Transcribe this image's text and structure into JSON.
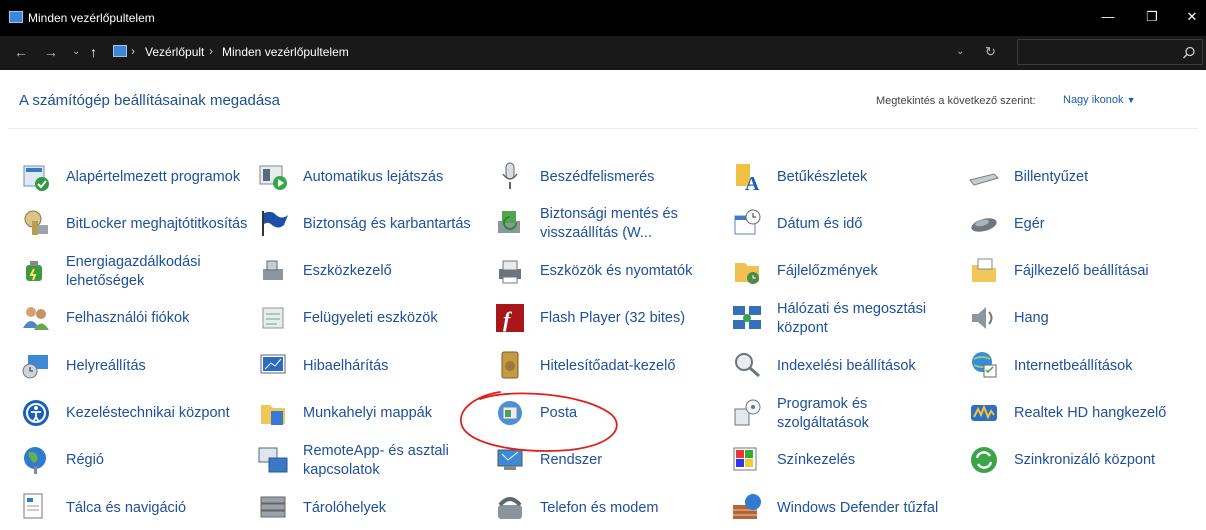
{
  "window": {
    "title": "Minden vezérlőpultelem",
    "minimize_glyph": "—",
    "restore_glyph": "❐",
    "close_glyph": "✕"
  },
  "address": {
    "crumbs": [
      "Vezérlőpult",
      "Minden vezérlőpultelem"
    ],
    "separator": "›",
    "search_placeholder": ""
  },
  "header": {
    "title": "A számítógép beállításainak megadása",
    "view_by_label": "Megtekintés a következő szerint:",
    "view_by_value": "Nagy ikonok"
  },
  "items": [
    {
      "label": "Alapértelmezett programok",
      "icon": "default-programs-icon"
    },
    {
      "label": "Automatikus lejátszás",
      "icon": "autoplay-icon"
    },
    {
      "label": "Beszédfelismerés",
      "icon": "microphone-icon"
    },
    {
      "label": "Betűkészletek",
      "icon": "fonts-icon"
    },
    {
      "label": "Billentyűzet",
      "icon": "keyboard-icon"
    },
    {
      "label": "BitLocker meghajtótitkosítás",
      "icon": "bitlocker-icon"
    },
    {
      "label": "Biztonság és karbantartás",
      "icon": "flag-icon"
    },
    {
      "label": "Biztonsági mentés és visszaállítás (W...",
      "icon": "backup-icon"
    },
    {
      "label": "Dátum és idő",
      "icon": "datetime-icon"
    },
    {
      "label": "Egér",
      "icon": "mouse-icon"
    },
    {
      "label": "Energiagazdálkodási lehetőségek",
      "icon": "power-icon"
    },
    {
      "label": "Eszközkezelő",
      "icon": "device-manager-icon"
    },
    {
      "label": "Eszközök és nyomtatók",
      "icon": "printer-icon"
    },
    {
      "label": "Fájlelőzmények",
      "icon": "file-history-icon"
    },
    {
      "label": "Fájlkezelő beállításai",
      "icon": "folder-options-icon"
    },
    {
      "label": "Felhasználói fiókok",
      "icon": "users-icon"
    },
    {
      "label": "Felügyeleti eszközök",
      "icon": "admin-tools-icon"
    },
    {
      "label": "Flash Player (32 bites)",
      "icon": "flash-icon"
    },
    {
      "label": "Hálózati és megosztási központ",
      "icon": "network-icon"
    },
    {
      "label": "Hang",
      "icon": "speaker-icon"
    },
    {
      "label": "Helyreállítás",
      "icon": "recovery-icon"
    },
    {
      "label": "Hibaelhárítás",
      "icon": "troubleshoot-icon"
    },
    {
      "label": "Hitelesítőadat-kezelő",
      "icon": "credential-icon"
    },
    {
      "label": "Indexelési beállítások",
      "icon": "indexing-icon"
    },
    {
      "label": "Internetbeállítások",
      "icon": "internet-options-icon"
    },
    {
      "label": "Kezeléstechnikai központ",
      "icon": "ease-of-access-icon"
    },
    {
      "label": "Munkahelyi mappák",
      "icon": "work-folders-icon"
    },
    {
      "label": "Posta",
      "icon": "mail-icon"
    },
    {
      "label": "Programok és szolgáltatások",
      "icon": "programs-icon"
    },
    {
      "label": "Realtek HD hangkezelő",
      "icon": "realtek-icon"
    },
    {
      "label": "Régió",
      "icon": "region-icon"
    },
    {
      "label": "RemoteApp- és asztali kapcsolatok",
      "icon": "remoteapp-icon"
    },
    {
      "label": "Rendszer",
      "icon": "system-icon"
    },
    {
      "label": "Színkezelés",
      "icon": "color-management-icon"
    },
    {
      "label": "Szinkronizáló központ",
      "icon": "sync-icon"
    },
    {
      "label": "Tálca és navigáció",
      "icon": "taskbar-icon"
    },
    {
      "label": "Tárolóhelyek",
      "icon": "storage-icon"
    },
    {
      "label": "Telefon és modem",
      "icon": "phone-icon"
    },
    {
      "label": "Windows Defender tűzfal",
      "icon": "firewall-icon"
    }
  ],
  "annotation": {
    "color": "#e0201c",
    "encircled_item": "Posta"
  }
}
